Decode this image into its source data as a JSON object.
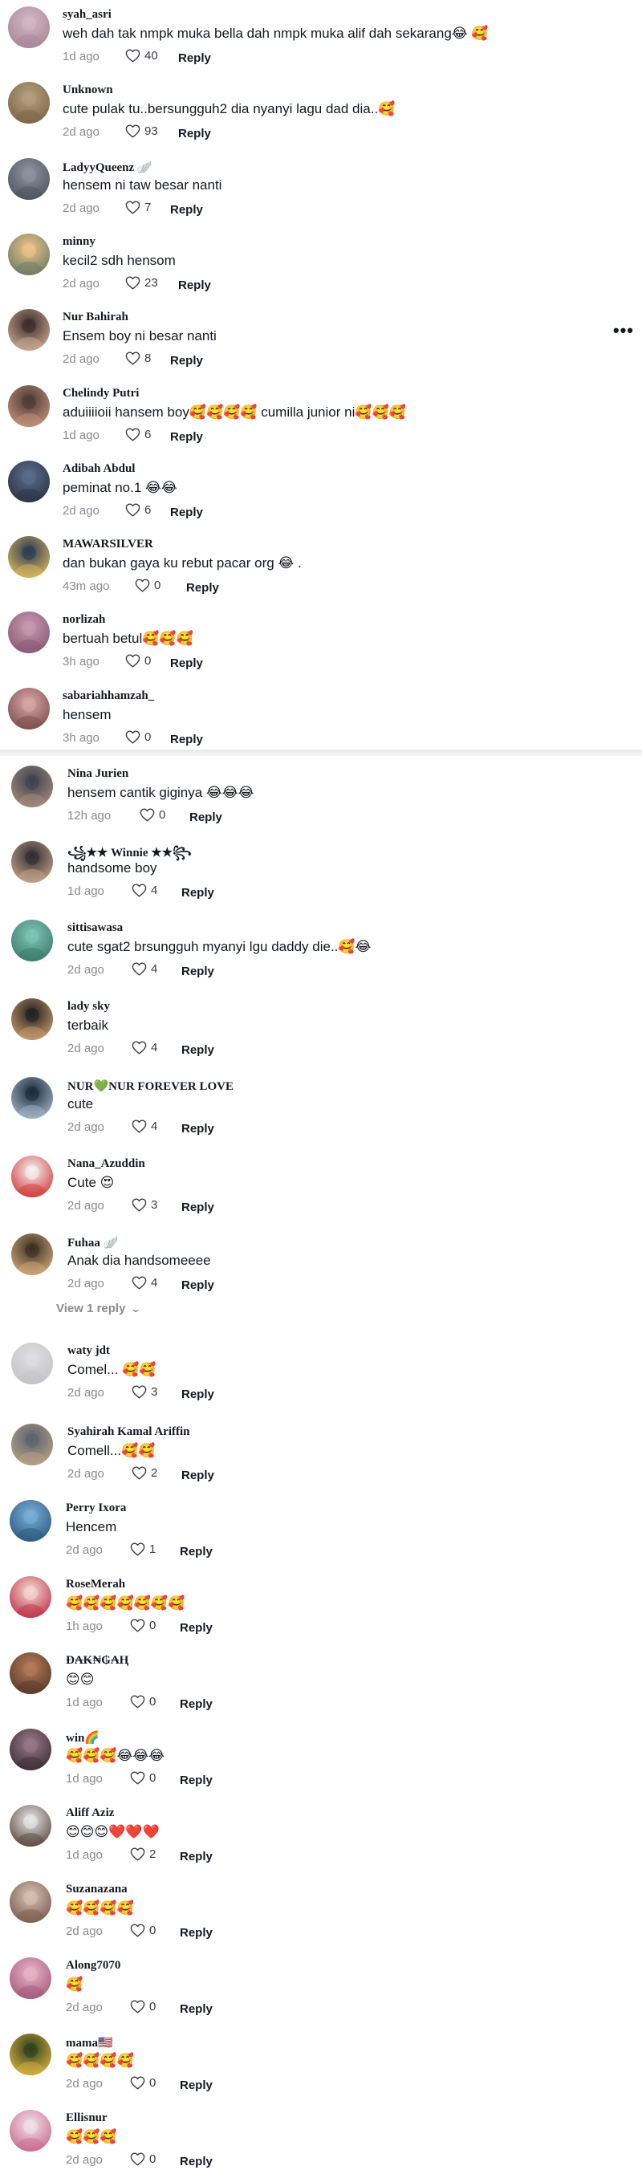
{
  "comments_a": [
    {
      "user": "syah_asri",
      "text": "weh dah tak nmpk muka bella dah nmpk muka alif dah sekarang😂 🥰",
      "time": "1d ago",
      "likes": "40",
      "reply": "Reply",
      "avatar_colors": [
        "#d3b8c4",
        "#a98697"
      ]
    },
    {
      "user": "Unknown",
      "text": "cute pulak tu..bersungguh2 dia nyanyi lagu dad dia..🥰",
      "time": "2d ago",
      "likes": "93",
      "reply": "Reply",
      "avatar_colors": [
        "#b7a07c",
        "#7d6648"
      ]
    },
    {
      "user": "LadyyQueenz 🪽",
      "text": "hensem ni taw besar nanti",
      "time": "2d ago",
      "likes": "7",
      "reply": "Reply",
      "avatar_colors": [
        "#8f95a1",
        "#4f5460"
      ]
    },
    {
      "user": "minny",
      "text": "kecil2 sdh hensom",
      "time": "2d ago",
      "likes": "23",
      "reply": "Reply",
      "avatar_colors": [
        "#f0c48a",
        "#6d7b63"
      ]
    },
    {
      "user": "Nur Bahirah",
      "text": "Ensem boy ni besar nanti",
      "time": "2d ago",
      "likes": "8",
      "reply": "Reply",
      "avatar_colors": [
        "#3b2a2a",
        "#c9a991"
      ]
    },
    {
      "user": "Chelindy Putri",
      "text": "aduiiiioii hansem boy🥰🥰🥰🥰 cumilla junior ni🥰🥰🥰",
      "time": "1d ago",
      "likes": "6",
      "reply": "Reply",
      "avatar_colors": [
        "#4b3a35",
        "#c28f7a"
      ]
    },
    {
      "user": "Adibah Abdul",
      "text": "peminat no.1 😂😂",
      "time": "2d ago",
      "likes": "6",
      "reply": "Reply",
      "avatar_colors": [
        "#5b6e8f",
        "#2c3346"
      ]
    },
    {
      "user": "MAWARSILVER",
      "text": "dan bukan gaya ku rebut pacar org 😂 .",
      "time": "43m ago",
      "likes": "0",
      "reply": "Reply",
      "avatar_colors": [
        "#2a3a55",
        "#d9b65e"
      ]
    },
    {
      "user": "norlizah",
      "text": "bertuah betul🥰🥰🥰",
      "time": "3h ago",
      "likes": "0",
      "reply": "Reply",
      "avatar_colors": [
        "#c89ab3",
        "#8a5a74"
      ]
    },
    {
      "user": "sabariahhamzah_",
      "text": "hensem",
      "time": "3h ago",
      "likes": "0",
      "reply": "Reply",
      "avatar_colors": [
        "#d9a7a7",
        "#7e4e4e"
      ]
    }
  ],
  "more_options": "•••",
  "comments_b": [
    {
      "user": "Nina Jurien",
      "text": "hensem cantik giginya 😂😂😂",
      "time": "12h ago",
      "likes": "0",
      "reply": "Reply",
      "avatar_colors": [
        "#3d4150",
        "#a58a7a"
      ]
    },
    {
      "user": "꧁★★ Winnie ★★꧂",
      "text": "handsome boy",
      "time": "1d ago",
      "likes": "4",
      "reply": "Reply",
      "avatar_colors": [
        "#2f2b30",
        "#c4a48a"
      ]
    },
    {
      "user": "sittisawasa",
      "text": "cute sgat2 brsungguh myanyi lgu daddy die..🥰😂",
      "time": "2d ago",
      "likes": "4",
      "reply": "Reply",
      "avatar_colors": [
        "#7fc6b7",
        "#3c7c70"
      ]
    },
    {
      "user": "lady sky",
      "text": "terbaik",
      "time": "2d ago",
      "likes": "4",
      "reply": "Reply",
      "avatar_colors": [
        "#1f1f22",
        "#c79a6a"
      ]
    },
    {
      "user": "NUR💚NUR FOREVER LOVE",
      "text": "cute",
      "time": "2d ago",
      "likes": "4",
      "reply": "Reply",
      "avatar_colors": [
        "#1b2a3a",
        "#9fb3c6"
      ]
    },
    {
      "user": "Nana_Azuddin",
      "text": "Cute 😍",
      "time": "2d ago",
      "likes": "3",
      "reply": "Reply",
      "avatar_colors": [
        "#f4f4f4",
        "#d13c3c"
      ]
    },
    {
      "user": "Fuhaa 🪽",
      "text": "Anak dia handsomeeee",
      "time": "2d ago",
      "likes": "4",
      "reply": "Reply",
      "avatar_colors": [
        "#3a2e24",
        "#d0a878"
      ]
    },
    {
      "user": "waty jdt",
      "text": "Comel... 🥰🥰",
      "time": "2d ago",
      "likes": "3",
      "reply": "Reply",
      "avatar_colors": [
        "#dedee1",
        "#c4c4c8"
      ]
    },
    {
      "user": "Syahirah Kamal Ariffin",
      "text": "Comell...🥰🥰",
      "time": "2d ago",
      "likes": "2",
      "reply": "Reply",
      "avatar_colors": [
        "#596270",
        "#b8a083"
      ]
    },
    {
      "user": "Perry Ixora",
      "text": "Hencem",
      "time": "2d ago",
      "likes": "1",
      "reply": "Reply",
      "avatar_colors": [
        "#7ab0d8",
        "#2f5a80"
      ]
    },
    {
      "user": "RoseMerah",
      "text": "🥰🥰🥰🥰🥰🥰🥰",
      "time": "1h ago",
      "likes": "0",
      "reply": "Reply",
      "avatar_colors": [
        "#f3ddd3",
        "#c0324a"
      ]
    },
    {
      "user": "Ð₳₭₦₲₳Ⱨ",
      "text": "😊😊",
      "time": "1d ago",
      "likes": "0",
      "reply": "Reply",
      "avatar_colors": [
        "#b77c5a",
        "#5a3a2a"
      ]
    },
    {
      "user": "win🌈",
      "text": "🥰🥰🥰😂😂😂",
      "time": "1d ago",
      "likes": "0",
      "reply": "Reply",
      "avatar_colors": [
        "#9a7a8a",
        "#3e2f36"
      ]
    },
    {
      "user": "Aliff Aziz",
      "text": "😊😊😊❤️❤️❤️",
      "time": "1d ago",
      "likes": "2",
      "reply": "Reply",
      "avatar_colors": [
        "#e9e9ea",
        "#5c4a40"
      ]
    },
    {
      "user": "Suzanazana",
      "text": "🥰🥰🥰🥰",
      "time": "2d ago",
      "likes": "0",
      "reply": "Reply",
      "avatar_colors": [
        "#d8c2b5",
        "#7a5d4f"
      ]
    },
    {
      "user": "Along7070",
      "text": "🥰",
      "time": "2d ago",
      "likes": "0",
      "reply": "Reply",
      "avatar_colors": [
        "#e8b6c8",
        "#a65a7c"
      ]
    },
    {
      "user": "mama🇺🇸",
      "text": "🥰🥰🥰🥰",
      "time": "2d ago",
      "likes": "0",
      "reply": "Reply",
      "avatar_colors": [
        "#2e3f1f",
        "#d5b040"
      ]
    },
    {
      "user": "Ellisnur",
      "text": "🥰🥰🥰",
      "time": "2d ago",
      "likes": "0",
      "reply": "Reply",
      "avatar_colors": [
        "#f1e3e8",
        "#c96c8e"
      ]
    }
  ],
  "view_replies_label": "View 1 reply"
}
